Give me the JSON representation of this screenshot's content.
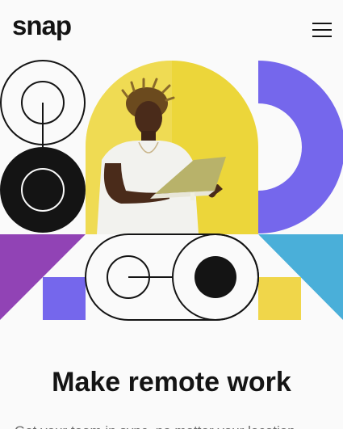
{
  "header": {
    "logo": "snap"
  },
  "icons": {
    "menu": "hamburger-menu-icon"
  },
  "hero": {
    "title": "Make remote work",
    "subtitle": "Get your team in sync, no matter your location."
  },
  "colors": {
    "background": "#fafafa",
    "text": "#141414",
    "muted": "#696969",
    "yellow": "#ecd63a",
    "purple": "#7567ec",
    "violet": "#9143b5",
    "cyan": "#4aafd9",
    "pale_yellow": "#f0d64a",
    "dark": "#141414"
  }
}
